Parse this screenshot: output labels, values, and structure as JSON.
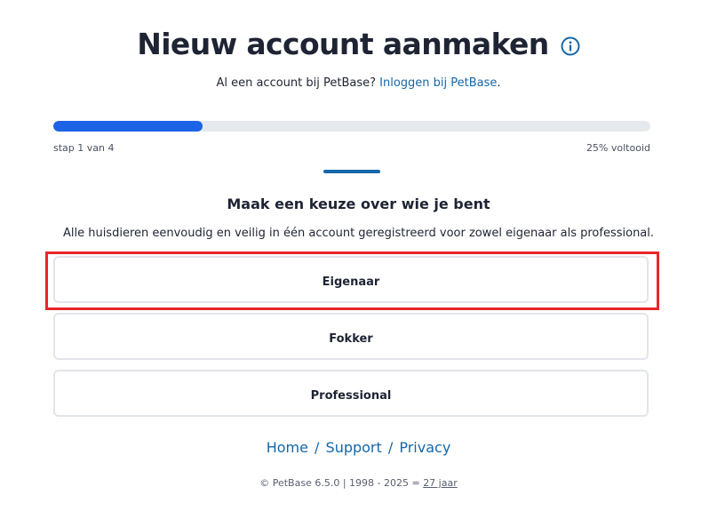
{
  "header": {
    "title": "Nieuw account aanmaken",
    "info_icon": "info-circle-icon",
    "subtitle_prefix": "Al een account bij PetBase? ",
    "login_link": "Inloggen bij PetBase",
    "subtitle_suffix": "."
  },
  "progress": {
    "fraction": 0.25,
    "step_label": "stap 1 van 4",
    "percent_label": "25% voltooid",
    "fill_color": "#1c63e6"
  },
  "section": {
    "title": "Maak een keuze over wie je bent",
    "description": "Alle huisdieren eenvoudig en veilig in één account geregistreerd voor zowel eigenaar als professional."
  },
  "options": [
    {
      "label": "Eigenaar",
      "highlighted": true
    },
    {
      "label": "Fokker"
    },
    {
      "label": "Professional"
    }
  ],
  "footer": {
    "links": [
      "Home",
      "Support",
      "Privacy"
    ],
    "separator": "/",
    "copyright_prefix": "© PetBase 6.5.0 | 1998 - 2025 = ",
    "years": "27 jaar"
  },
  "colors": {
    "accent": "#1467a9",
    "highlight": "#e8262b"
  }
}
